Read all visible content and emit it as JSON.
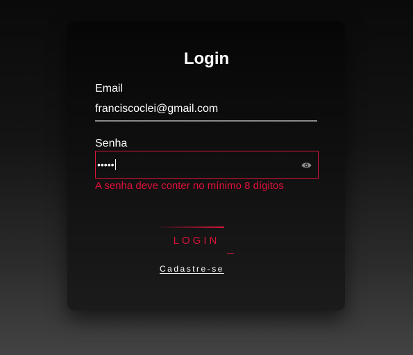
{
  "form": {
    "title": "Login",
    "email_label": "Email",
    "email_value": "franciscoclei@gmail.com",
    "password_label": "Senha",
    "password_mask": "•••••",
    "error_message": "A senha deve conter no mínimo 8 dígitos",
    "login_button": "LOGIN",
    "signup_link": "Cadastre-se"
  },
  "icons": {
    "toggle_visibility": "eye-icon"
  },
  "colors": {
    "accent": "#d6143a",
    "error": "#e0103c",
    "text": "#ffffff",
    "underline": "#8a8a8a"
  }
}
